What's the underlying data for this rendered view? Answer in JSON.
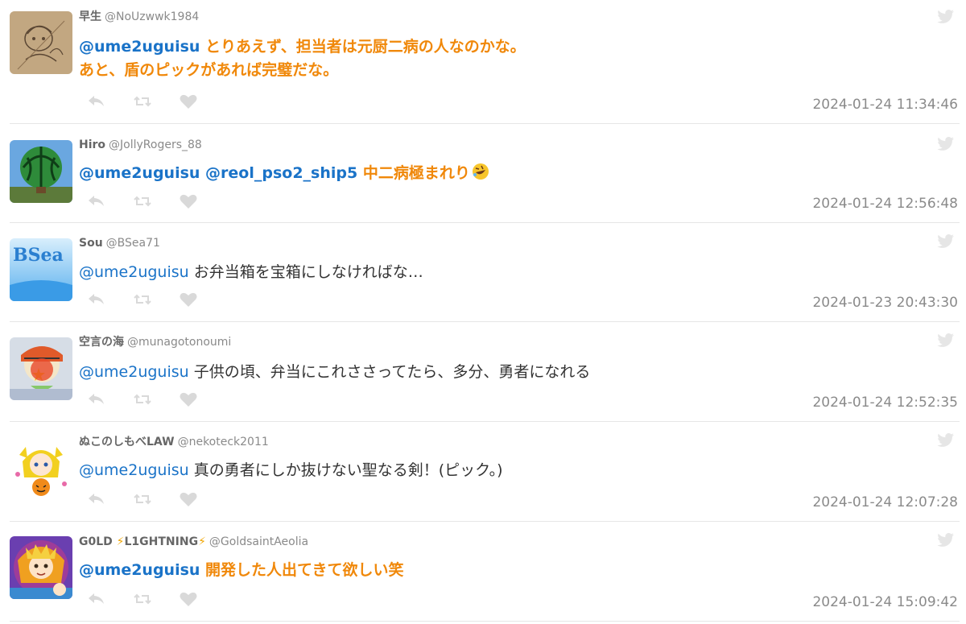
{
  "tweets": [
    {
      "name": "早生",
      "handle": "@NoUzwwk1984",
      "mention": "@ume2uguisu",
      "text_line1": " とりあえず、担当者は元厨二病の人なのかな。",
      "text_line2": "あと、盾のピックがあれば完璧だな。",
      "timestamp": "2024-01-24 11:34:46",
      "emphasized": true,
      "avatar_icon": "sketch-avatar"
    },
    {
      "name": "Hiro",
      "handle": "@JollyRogers_88",
      "mention": "@ume2uguisu @reol_pso2_ship5",
      "text_line1": " 中二病極まれり",
      "emoji": "rolling-on-floor-laughing-emoji",
      "timestamp": "2024-01-24 12:56:48",
      "emphasized": true,
      "avatar_icon": "watermelon-balloon-avatar"
    },
    {
      "name": "Sou",
      "handle": "@BSea71",
      "mention": "@ume2uguisu",
      "text_line1": " お弁当箱を宝箱にしなければな…",
      "timestamp": "2024-01-23 20:43:30",
      "emphasized": false,
      "avatar_icon": "bsea-logo-avatar",
      "avatar_text": "BSea"
    },
    {
      "name": "空言の海",
      "handle": "@munagotonoumi",
      "mention": "@ume2uguisu",
      "text_line1": " 子供の頃、弁当にこれささってたら、多分、勇者になれる",
      "timestamp": "2024-01-24 12:52:35",
      "emphasized": false,
      "avatar_icon": "drawing-character-avatar"
    },
    {
      "name": "ぬこのしもべLAW",
      "handle": "@nekoteck2011",
      "mention": "@ume2uguisu",
      "text_line1": " 真の勇者にしか抜けない聖なる剣！(ピック。)",
      "timestamp": "2024-01-24 12:07:28",
      "emphasized": false,
      "avatar_icon": "anime-girl-avatar"
    },
    {
      "name_prefix": "G0LD ",
      "name_mid": "L1GHTNING",
      "bolt": "⚡",
      "handle": "@GoldsaintAeolia",
      "mention": "@ume2uguisu",
      "text_line1": " 開発した人出てきて欲しい笑",
      "timestamp": "2024-01-24 15:09:42",
      "emphasized": true,
      "avatar_icon": "gold-saint-avatar"
    }
  ],
  "icons": {
    "reply": "reply-icon",
    "retweet": "retweet-icon",
    "like": "heart-icon",
    "source": "twitter-bird-icon"
  },
  "colors": {
    "mention": "#1a73c8",
    "emphasis": "#f0880a",
    "muted": "#8a8a8a",
    "icon": "#d9d9d9",
    "divider": "#e6e6e6"
  }
}
